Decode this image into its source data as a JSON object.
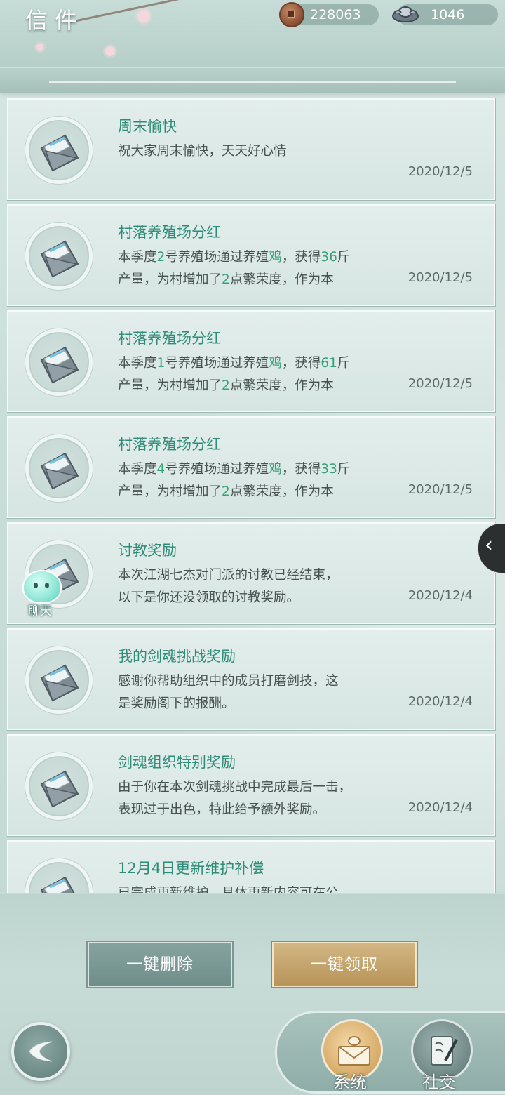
{
  "header": {
    "title": "信件",
    "copper": "228063",
    "silver": "1046"
  },
  "mails": [
    {
      "title": "周末愉快",
      "body": [
        {
          "t": "祝大家周末愉快，天天好心情"
        }
      ],
      "date": "2020/12/5"
    },
    {
      "title": "村落养殖场分红",
      "body": [
        {
          "t": "本季度"
        },
        {
          "t": "2",
          "hl": true
        },
        {
          "t": "号养殖场通过养殖"
        },
        {
          "t": "鸡",
          "hl": true
        },
        {
          "t": "，获得"
        },
        {
          "t": "36",
          "hl": true
        },
        {
          "t": "斤\n产量，为村增加了"
        },
        {
          "t": "2",
          "hl": true
        },
        {
          "t": "点繁荣度，作为本"
        }
      ],
      "date": "2020/12/5"
    },
    {
      "title": "村落养殖场分红",
      "body": [
        {
          "t": "本季度"
        },
        {
          "t": "1",
          "hl": true
        },
        {
          "t": "号养殖场通过养殖"
        },
        {
          "t": "鸡",
          "hl": true
        },
        {
          "t": "，获得"
        },
        {
          "t": "61",
          "hl": true
        },
        {
          "t": "斤\n产量，为村增加了"
        },
        {
          "t": "2",
          "hl": true
        },
        {
          "t": "点繁荣度，作为本"
        }
      ],
      "date": "2020/12/5"
    },
    {
      "title": "村落养殖场分红",
      "body": [
        {
          "t": "本季度"
        },
        {
          "t": "4",
          "hl": true
        },
        {
          "t": "号养殖场通过养殖"
        },
        {
          "t": "鸡",
          "hl": true
        },
        {
          "t": "，获得"
        },
        {
          "t": "33",
          "hl": true
        },
        {
          "t": "斤\n产量，为村增加了"
        },
        {
          "t": "2",
          "hl": true
        },
        {
          "t": "点繁荣度，作为本"
        }
      ],
      "date": "2020/12/5"
    },
    {
      "title": "讨教奖励",
      "body": [
        {
          "t": "本次江湖七杰对门派的讨教已经结束，\n以下是你还没领取的讨教奖励。"
        }
      ],
      "date": "2020/12/4"
    },
    {
      "title": "我的剑魂挑战奖励",
      "body": [
        {
          "t": "感谢你帮助组织中的成员打磨剑技，这\n是奖励阁下的报酬。"
        }
      ],
      "date": "2020/12/4"
    },
    {
      "title": "剑魂组织特别奖励",
      "body": [
        {
          "t": "由于你在本次剑魂挑战中完成最后一击，\n表现过于出色，特此给予额外奖励。"
        }
      ],
      "date": "2020/12/4"
    },
    {
      "title": "12月4日更新维护补偿",
      "body": [
        {
          "t": "已完成更新维护，具体更新内容可在公"
        }
      ],
      "date": ""
    }
  ],
  "chat": {
    "label": "聊天"
  },
  "buttons": {
    "delete_all": "一键删除",
    "claim_all": "一键领取"
  },
  "tabs": {
    "system": "系统",
    "social": "社交"
  },
  "colors": {
    "title_green": "#2f8c78",
    "highlight_green": "#35a074",
    "claim_gold": "#b89459"
  }
}
